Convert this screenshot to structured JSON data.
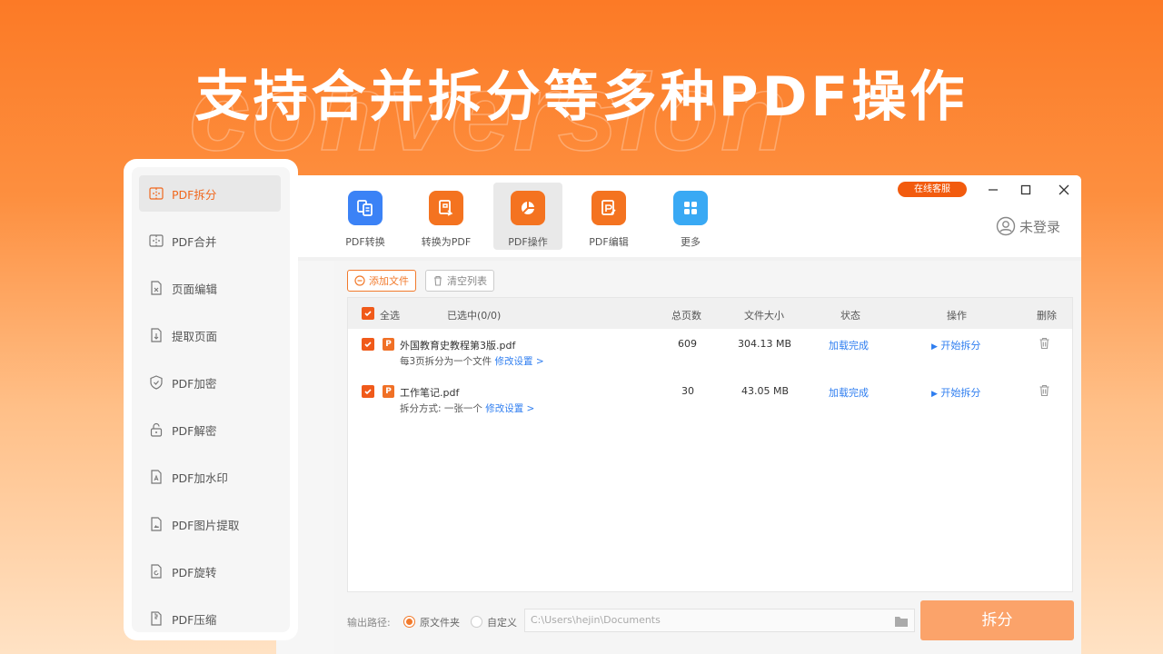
{
  "headline": "支持合并拆分等多种PDF操作",
  "bg_word": "conversion",
  "toolbar": {
    "items": [
      {
        "label": "PDF转换",
        "color": "#3b82f6"
      },
      {
        "label": "转换为PDF",
        "color": "#f47320"
      },
      {
        "label": "PDF操作",
        "color": "#f47320"
      },
      {
        "label": "PDF编辑",
        "color": "#f47320"
      },
      {
        "label": "更多",
        "color": "#39a9f4"
      }
    ],
    "active_index": 2,
    "service_label": "在线客服",
    "login_label": "未登录"
  },
  "sidebar": {
    "items": [
      {
        "label": "PDF拆分",
        "icon": "split-icon"
      },
      {
        "label": "PDF合并",
        "icon": "merge-icon"
      },
      {
        "label": "页面编辑",
        "icon": "page-edit-icon"
      },
      {
        "label": "提取页面",
        "icon": "extract-page-icon"
      },
      {
        "label": "PDF加密",
        "icon": "shield-icon"
      },
      {
        "label": "PDF解密",
        "icon": "unlock-icon"
      },
      {
        "label": "PDF加水印",
        "icon": "watermark-icon"
      },
      {
        "label": "PDF图片提取",
        "icon": "image-extract-icon"
      },
      {
        "label": "PDF旋转",
        "icon": "rotate-icon"
      },
      {
        "label": "PDF压缩",
        "icon": "compress-icon"
      }
    ],
    "active_index": 0
  },
  "actions": {
    "add_file": "添加文件",
    "clear_list": "清空列表"
  },
  "table": {
    "select_all": "全选",
    "selected_count": "已选中(0/0)",
    "headers": {
      "pages": "总页数",
      "size": "文件大小",
      "status": "状态",
      "action": "操作",
      "delete": "删除"
    },
    "rows": [
      {
        "name": "外国教育史教程第3版.pdf",
        "sub": "每3页拆分为一个文件",
        "link": "修改设置 >",
        "pages": "609",
        "size": "304.13 MB",
        "status": "加载完成",
        "action": "开始拆分"
      },
      {
        "name": "工作笔记.pdf",
        "sub": "拆分方式: 一张一个",
        "link": "修改设置 >",
        "pages": "30",
        "size": "43.05 MB",
        "status": "加载完成",
        "action": "开始拆分"
      }
    ]
  },
  "output": {
    "label": "输出路径:",
    "option_original": "原文件夹",
    "option_custom": "自定义",
    "path": "C:\\Users\\hejin\\Documents",
    "split_button": "拆分"
  },
  "colors": {
    "accent": "#f0681e",
    "link": "#2f7ef0"
  }
}
